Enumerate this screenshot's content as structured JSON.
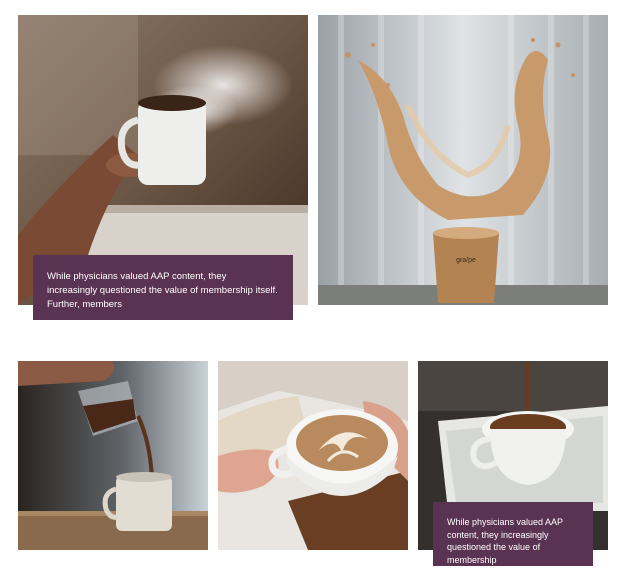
{
  "gallery": {
    "top_row": [
      {
        "image": "hand-holding-steaming-coffee-mug"
      },
      {
        "image": "coffee-splashing-from-paper-cup"
      }
    ],
    "bottom_row": [
      {
        "image": "coffee-poured-into-mug"
      },
      {
        "image": "latte-art-cup-in-hands"
      },
      {
        "image": "coffee-poured-into-cup-on-tray"
      }
    ],
    "caption_top": "While physicians valued AAP content, they increasingly questioned the value of membership itself. Further, members",
    "caption_bottom": "While physicians valued AAP content, they increasingly questioned the value of membership",
    "cup_brand": "gra/pe"
  },
  "colors": {
    "caption_bg": "#5a3352",
    "caption_text": "#ffffff"
  }
}
